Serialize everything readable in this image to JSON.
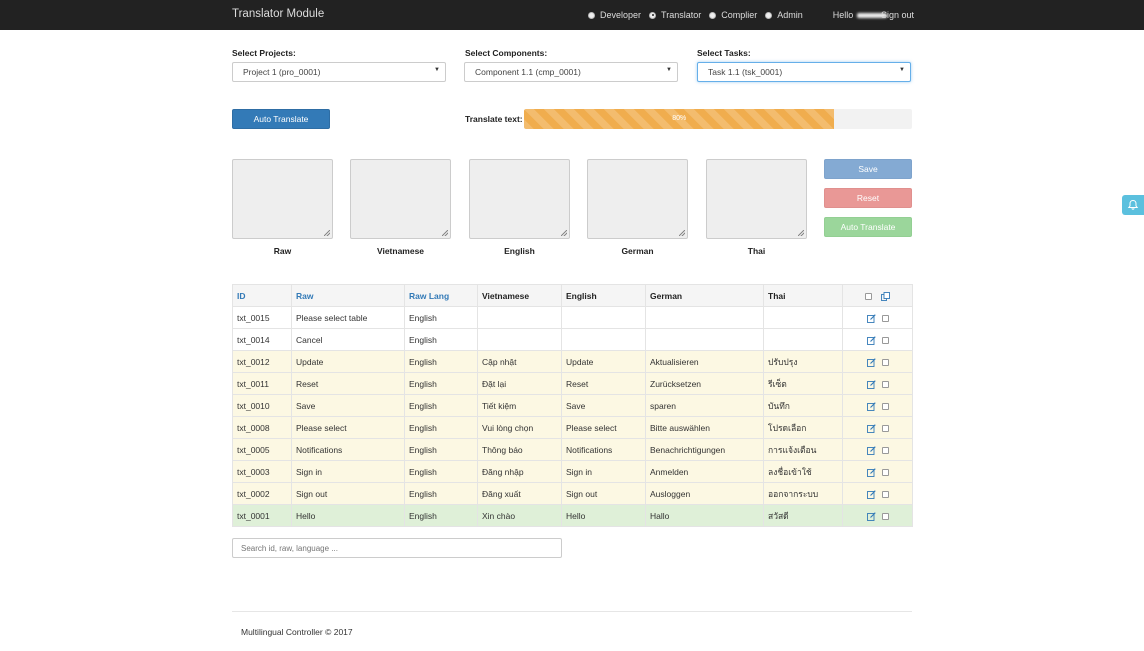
{
  "navbar": {
    "brand": "Translator Module",
    "roles": [
      {
        "label": "Developer",
        "checked": false
      },
      {
        "label": "Translator",
        "checked": true
      },
      {
        "label": "Complier",
        "checked": false
      },
      {
        "label": "Admin",
        "checked": false
      }
    ],
    "hello_label": "Hello",
    "signout_label": "Sign out"
  },
  "filters": {
    "projects": {
      "label": "Select Projects:",
      "value": "Project 1 (pro_0001)"
    },
    "components": {
      "label": "Select Components:",
      "value": "Component 1.1 (cmp_0001)"
    },
    "tasks": {
      "label": "Select Tasks:",
      "value": "Task 1.1 (tsk_0001)"
    }
  },
  "toolbar": {
    "auto_translate_label": "Auto Translate",
    "progress_label": "Translate text:",
    "progress_text": "80%",
    "progress_value": 0.8
  },
  "editor": {
    "fields": [
      "Raw",
      "Vietnamese",
      "English",
      "German",
      "Thai"
    ],
    "save_label": "Save",
    "reset_label": "Reset",
    "auto_translate_label": "Auto Translate"
  },
  "table": {
    "headers": [
      "ID",
      "Raw",
      "Raw Lang",
      "Vietnamese",
      "English",
      "German",
      "Thai"
    ],
    "rows": [
      {
        "id": "txt_0015",
        "raw": "Please select table",
        "lang": "English",
        "vi": "",
        "en": "",
        "de": "",
        "th": "",
        "status": "plain"
      },
      {
        "id": "txt_0014",
        "raw": "Cancel",
        "lang": "English",
        "vi": "",
        "en": "",
        "de": "",
        "th": "",
        "status": "plain"
      },
      {
        "id": "txt_0012",
        "raw": "Update",
        "lang": "English",
        "vi": "Cập nhật",
        "en": "Update",
        "de": "Aktualisieren",
        "th": "ปรับปรุง",
        "status": "warn"
      },
      {
        "id": "txt_0011",
        "raw": "Reset",
        "lang": "English",
        "vi": "Đặt lại",
        "en": "Reset",
        "de": "Zurücksetzen",
        "th": "รีเซ็ต",
        "status": "warn"
      },
      {
        "id": "txt_0010",
        "raw": "Save",
        "lang": "English",
        "vi": "Tiết kiệm",
        "en": "Save",
        "de": "sparen",
        "th": "บันทึก",
        "status": "warn"
      },
      {
        "id": "txt_0008",
        "raw": "Please select",
        "lang": "English",
        "vi": "Vui lòng chọn",
        "en": "Please select",
        "de": "Bitte auswählen",
        "th": "โปรดเลือก",
        "status": "warn"
      },
      {
        "id": "txt_0005",
        "raw": "Notifications",
        "lang": "English",
        "vi": "Thông báo",
        "en": "Notifications",
        "de": "Benachrichtigungen",
        "th": "การแจ้งเตือน",
        "status": "warn"
      },
      {
        "id": "txt_0003",
        "raw": "Sign in",
        "lang": "English",
        "vi": "Đăng nhập",
        "en": "Sign in",
        "de": "Anmelden",
        "th": "ลงชื่อเข้าใช้",
        "status": "warn"
      },
      {
        "id": "txt_0002",
        "raw": "Sign out",
        "lang": "English",
        "vi": "Đăng xuất",
        "en": "Sign out",
        "de": "Ausloggen",
        "th": "ออกจากระบบ",
        "status": "warn"
      },
      {
        "id": "txt_0001",
        "raw": "Hello",
        "lang": "English",
        "vi": "Xin chào",
        "en": "Hello",
        "de": "Hallo",
        "th": "สวัสดี",
        "status": "succ"
      }
    ]
  },
  "search": {
    "placeholder": "Search id, raw, language ..."
  },
  "footer": {
    "text": "Multilingual Controller © 2017"
  },
  "colors": {
    "primary": "#337ab7",
    "warning": "#f0ad4e",
    "row_warning": "#fcf8e3",
    "row_success": "#dff0d8",
    "navbar": "#222222",
    "info": "#5bc0de"
  }
}
